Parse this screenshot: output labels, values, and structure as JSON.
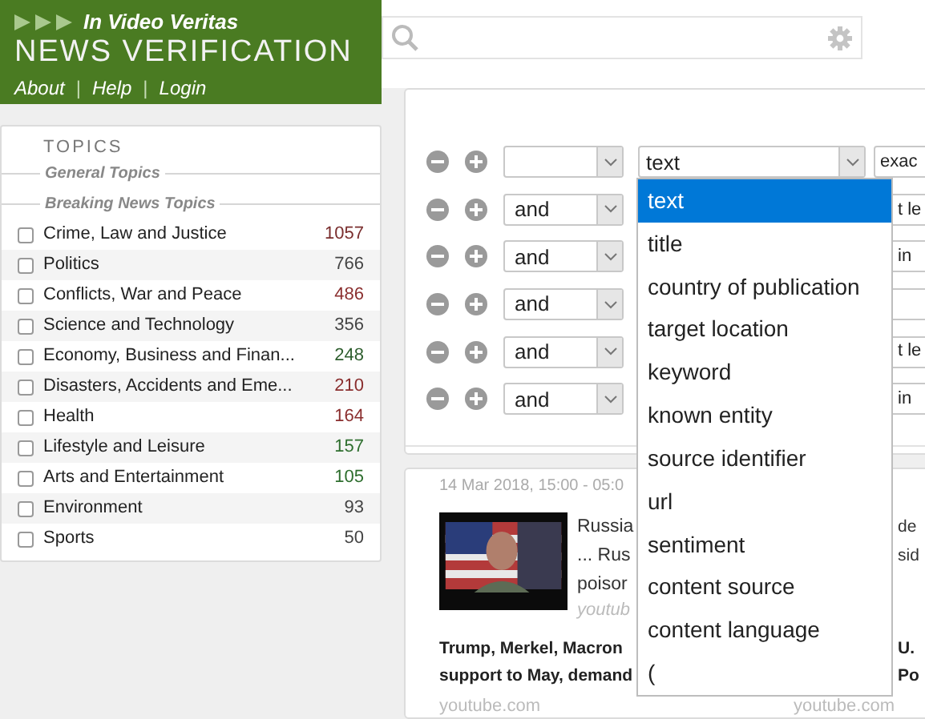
{
  "header": {
    "tagline": "In Video Veritas",
    "title": "NEWS VERIFICATION",
    "links": [
      "About",
      "Help",
      "Login"
    ],
    "separator": "|"
  },
  "topics": {
    "title": "TOPICS",
    "groups": [
      "General Topics",
      "Breaking News Topics"
    ],
    "items": [
      {
        "label": "Crime, Law and Justice",
        "count": "1057",
        "color": "#7a2e2e",
        "checked": false
      },
      {
        "label": "Politics",
        "count": "766",
        "color": "#444444",
        "checked": false
      },
      {
        "label": "Conflicts, War and Peace",
        "count": "486",
        "color": "#8a2e2e",
        "checked": false
      },
      {
        "label": "Science and Technology",
        "count": "356",
        "color": "#444444",
        "checked": false
      },
      {
        "label": "Economy, Business and Finan...",
        "count": "248",
        "color": "#2e5e2e",
        "checked": false
      },
      {
        "label": "Disasters, Accidents and Eme...",
        "count": "210",
        "color": "#8a2e2e",
        "checked": false
      },
      {
        "label": "Health",
        "count": "164",
        "color": "#8a2e2e",
        "checked": false
      },
      {
        "label": "Lifestyle and Leisure",
        "count": "157",
        "color": "#2e6e2e",
        "checked": false
      },
      {
        "label": "Arts and Entertainment",
        "count": "105",
        "color": "#2e6e2e",
        "checked": false
      },
      {
        "label": "Environment",
        "count": "93",
        "color": "#444444",
        "checked": false
      },
      {
        "label": "Sports",
        "count": "50",
        "color": "#444444",
        "checked": false
      }
    ]
  },
  "query": {
    "rows": [
      {
        "connector": "",
        "field": "text",
        "operator": "exac"
      },
      {
        "connector": "and",
        "operator": "t le"
      },
      {
        "connector": "and",
        "operator": "in"
      },
      {
        "connector": "and"
      },
      {
        "connector": "and",
        "operator": "t le"
      },
      {
        "connector": "and",
        "operator": "in"
      }
    ]
  },
  "dropdown": {
    "options": [
      {
        "label": "text",
        "selected": true
      },
      {
        "label": "title",
        "selected": false
      },
      {
        "label": "country of publication",
        "selected": false
      },
      {
        "label": "target location",
        "selected": false
      },
      {
        "label": "keyword",
        "selected": false
      },
      {
        "label": "known entity",
        "selected": false
      },
      {
        "label": "source identifier",
        "selected": false
      },
      {
        "label": "url",
        "selected": false
      },
      {
        "label": "sentiment",
        "selected": false
      },
      {
        "label": "content source",
        "selected": false
      },
      {
        "label": "content language",
        "selected": false
      },
      {
        "label": "(",
        "selected": false
      }
    ]
  },
  "news": {
    "date": "14 Mar 2018, 15:00 - 05:0",
    "left": {
      "title_lines": [
        "Russia",
        "... Rus",
        "poisor"
      ],
      "source": "youtub",
      "headline_lines": [
        "Trump, Merkel, Macron",
        "support to May, demand"
      ],
      "bottom_source": "youtube.com"
    },
    "right": {
      "title_lines": [
        "de",
        "sid"
      ],
      "headline_lines": [
        "U.",
        "Po"
      ],
      "bottom_source": "youtube.com"
    }
  }
}
